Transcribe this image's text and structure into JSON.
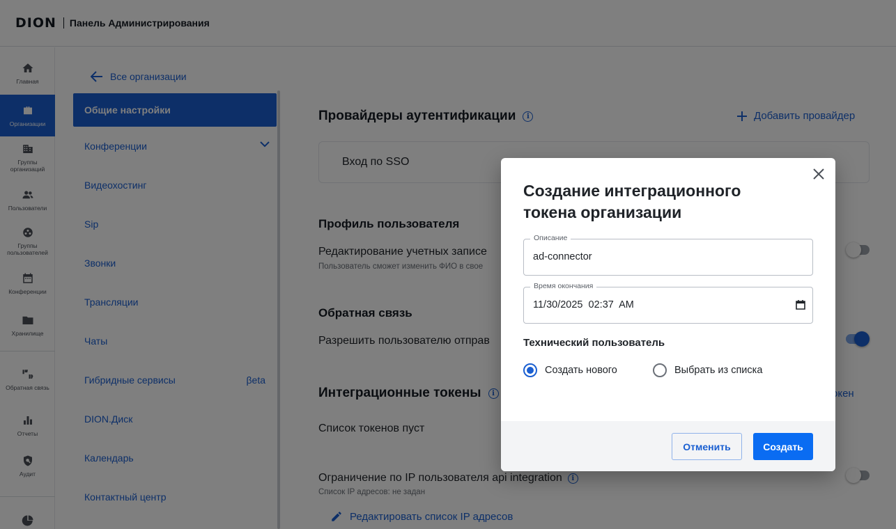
{
  "header": {
    "logo": "DION",
    "title": "Панель Администрирования"
  },
  "rail": [
    {
      "label": "Главная",
      "icon": "home-icon"
    },
    {
      "label": "Организации",
      "icon": "briefcase-icon",
      "active": true
    },
    {
      "label": "Группы организаций",
      "icon": "building-icon"
    },
    {
      "label": "Пользователи",
      "icon": "users-icon"
    },
    {
      "label": "Группы пользователей",
      "icon": "user-group-icon"
    },
    {
      "label": "Конференции",
      "icon": "calendar-icon"
    },
    {
      "label": "Хранилище",
      "icon": "folder-icon"
    },
    {
      "label": "Обратная связь",
      "icon": "thumbs-icon"
    },
    {
      "label": "Отчеты",
      "icon": "bar-chart-icon"
    },
    {
      "label": "Аудит",
      "icon": "audit-shield-icon"
    },
    {
      "label": "",
      "icon": "pie-chart-icon"
    }
  ],
  "subnav": {
    "back_label": "Все организации",
    "items": [
      {
        "label": "Общие настройки",
        "active": true
      },
      {
        "label": "Конференции",
        "expandable": true
      },
      {
        "label": "Видеохостинг"
      },
      {
        "label": "Sip"
      },
      {
        "label": "Звонки"
      },
      {
        "label": "Трансляции"
      },
      {
        "label": "Чаты"
      },
      {
        "label": "Гибридные сервисы",
        "badge": "βeta"
      },
      {
        "label": "DION.Диск"
      },
      {
        "label": "Календарь"
      },
      {
        "label": "Контактный центр"
      }
    ]
  },
  "main": {
    "providers": {
      "title": "Провайдеры аутентификации",
      "add_label": "Добавить провайдер",
      "items": [
        "Вход по SSO"
      ]
    },
    "profile": {
      "title": "Профиль пользователя",
      "edit_title": "Редактирование учетных записе",
      "edit_sub": "Пользователь сможет изменить ФИО в свое",
      "edit_enabled": false
    },
    "feedback": {
      "title": "Обратная связь",
      "allow_label": "Разрешить пользователю отправ",
      "allow_enabled": true
    },
    "tokens": {
      "title": "Интеграционные токены",
      "add_label_tail": "окен",
      "empty_text": "Список токенов пуст"
    },
    "ip": {
      "title": "Ограничение по IP пользователя api integration",
      "sub": "Список IP адресов: не задан",
      "enabled": false,
      "edit_label": "Редактировать список IP адресов"
    }
  },
  "dialog": {
    "title": "Создание интеграционного токена организации",
    "description": {
      "label": "Описание",
      "value": "ad-connector"
    },
    "expiry": {
      "label": "Время окончания",
      "value": "11/30/2025  02:37  AM"
    },
    "tech_user_title": "Технический пользователь",
    "options": [
      {
        "label": "Создать нового",
        "checked": true
      },
      {
        "label": "Выбрать из списка",
        "checked": false
      }
    ],
    "cancel_label": "Отменить",
    "create_label": "Создать"
  },
  "colors": {
    "accent": "#1a5fd1",
    "primary_button": "#0a6cf2",
    "overlay": "rgba(0,0,0,0.5)"
  }
}
